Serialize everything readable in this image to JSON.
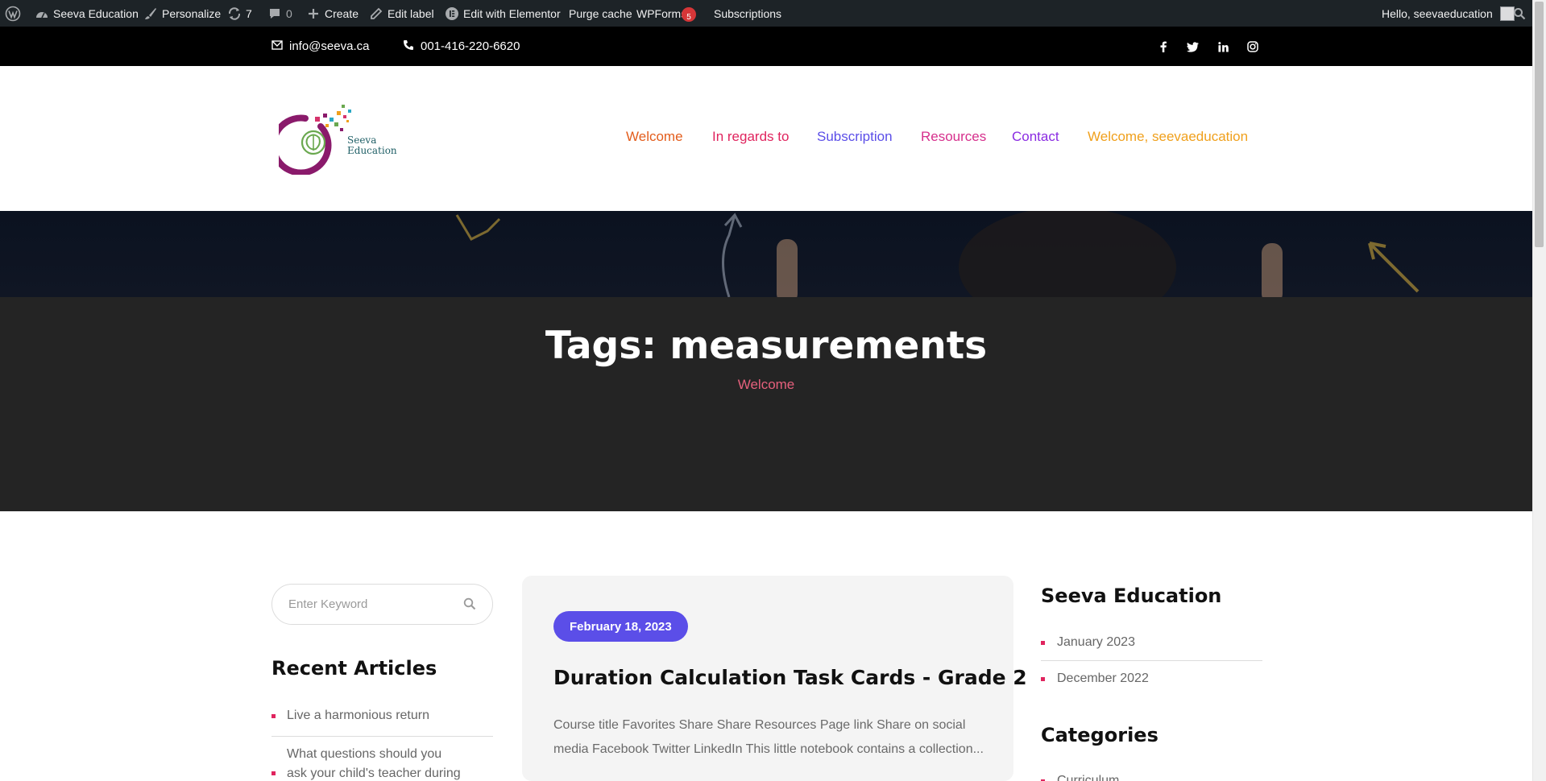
{
  "admin_bar": {
    "site_name": "Seeva Education",
    "personalize": "Personalize",
    "updates_count": "7",
    "comments_count": "0",
    "create": "Create",
    "edit_label": "Edit label",
    "edit_elementor": "Edit with Elementor",
    "purge_cache": "Purge cache",
    "wpforms": "WPForms",
    "wpforms_badge": "5",
    "subscriptions": "Subscriptions",
    "greeting": "Hello, seevaeducation"
  },
  "topbar": {
    "email": "info@seeva.ca",
    "phone": "001-416-220-6620",
    "social_icons": [
      "facebook-icon",
      "twitter-icon",
      "linkedin-icon",
      "instagram-icon"
    ]
  },
  "header": {
    "logo_line1": "Seeva",
    "logo_line2": "Education",
    "nav": [
      {
        "label": "Welcome",
        "color": "#e35d1c"
      },
      {
        "label": "In regards to",
        "color": "#e0245e"
      },
      {
        "label": "Subscription",
        "color": "#5b4ee8"
      },
      {
        "label": "Resources",
        "color": "#d62f8c"
      },
      {
        "label": "Contact",
        "color": "#8a2be2"
      },
      {
        "label": "Welcome, seevaeducation",
        "color": "#f0a01c"
      }
    ]
  },
  "hero": {
    "title": "Tags: measurements",
    "breadcrumb": "Welcome"
  },
  "sidebar_left": {
    "search_placeholder": "Enter Keyword",
    "recent_title": "Recent Articles",
    "recent_items": [
      "Live a harmonious return",
      "What questions should you ask your child's teacher during"
    ]
  },
  "post": {
    "date": "February 18, 2023",
    "title": "Duration Calculation Task Cards - Grade 2",
    "excerpt": "Course title Favorites Share Share Resources Page link Share on social media Facebook Twitter LinkedIn This little notebook contains a collection..."
  },
  "sidebar_right": {
    "archive_title": "Seeva Education",
    "archives": [
      "January 2023",
      "December 2022"
    ],
    "categories_title": "Categories",
    "categories": [
      "Curriculum"
    ]
  },
  "colors": {
    "accent_purple": "#5b4ee8",
    "accent_pink": "#e0245e",
    "hero_dark": "#242424"
  }
}
